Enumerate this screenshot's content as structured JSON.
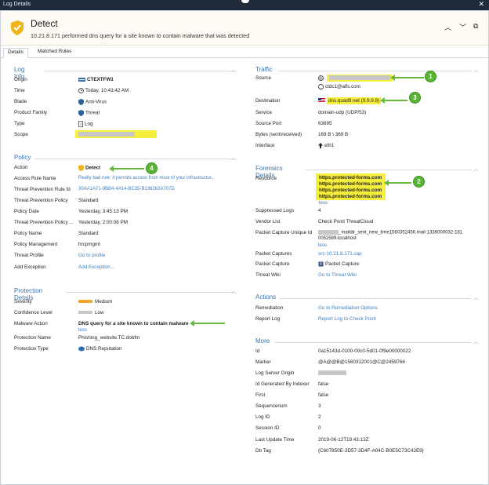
{
  "window": {
    "title": "Log Details",
    "close": "✕"
  },
  "header": {
    "title": "Detect",
    "subtitle": "10.21.8.171 performed dns query for a site known to contain malware that was detected",
    "prev": "︿",
    "next": "﹀",
    "copy": "⧉"
  },
  "tabs": [
    "Details",
    "Matched Rules"
  ],
  "log_info": {
    "title": "Log Info",
    "rows": [
      {
        "label": "Origin",
        "value": "CTEXTFW1"
      },
      {
        "label": "Time",
        "value": "Today, 10:43:42 AM"
      },
      {
        "label": "Blade",
        "value": "Anti-Virus"
      },
      {
        "label": "Product Family",
        "value": "Threat"
      },
      {
        "label": "Type",
        "value": "Log"
      },
      {
        "label": "Scope",
        "value": ""
      }
    ]
  },
  "policy": {
    "title": "Policy",
    "rows": [
      {
        "label": "Action",
        "value": "Detect"
      },
      {
        "label": "Access Rule Name",
        "value": "Really bad rule: it permits access from most of your infrastructur..."
      },
      {
        "label": "Threat Prevention Rule Id",
        "value": "30AA1A71-9BB4-4A14-BC35-B138262A707D"
      },
      {
        "label": "Threat Prevention Policy",
        "value": "Standard"
      },
      {
        "label": "Policy Date",
        "value": "Yesterday, 3:45:13 PM"
      },
      {
        "label": "Threat Prevention Policy ...",
        "value": "Yesterday, 2:00:08 PM"
      },
      {
        "label": "Policy Name",
        "value": "Standard"
      },
      {
        "label": "Policy Management",
        "value": "hrcpmgmt"
      },
      {
        "label": "Threat Profile",
        "value": "Go to profile"
      },
      {
        "label": "Add Exception",
        "value": "Add Exception..."
      }
    ]
  },
  "protection": {
    "title": "Protection Details",
    "rows": [
      {
        "label": "Severity",
        "value": "Medium"
      },
      {
        "label": "Confidence Level",
        "value": "Low"
      },
      {
        "label": "Malware Action",
        "value": "DNS query for a site known to contain malware"
      },
      {
        "label": "",
        "value": "less"
      },
      {
        "label": "Protection Name",
        "value": "Phishing_website.TC.dobfm"
      },
      {
        "label": "Protection Type",
        "value": "DNS Reputation"
      }
    ]
  },
  "traffic": {
    "title": "Traffic",
    "rows": [
      {
        "label": "Source",
        "value": ""
      },
      {
        "label": "",
        "value": "ctdc1@alfs.com"
      },
      {
        "label": "Destination",
        "value": "dns.quad9.net (9.9.9.9)"
      },
      {
        "label": "Service",
        "value": "domain-udp (UDP/53)"
      },
      {
        "label": "Source Port",
        "value": "63695"
      },
      {
        "label": "Bytes (sent\\received)",
        "value": "169 B \\ 369 B"
      },
      {
        "label": "Interface",
        "value": "eth1"
      }
    ]
  },
  "forensics": {
    "title": "Forensics Details",
    "resource_label": "Resource",
    "resources": [
      "https.protected-forms.com",
      "https.protected-forms.com",
      "https.protected-forms.com",
      "https.protected-forms.com"
    ],
    "resource_less": "less",
    "rows": [
      {
        "label": "Suppressed Logs",
        "value": "4"
      },
      {
        "label": "Vendor List",
        "value": "Check Point ThreatCloud"
      },
      {
        "label": "Packet Capture Unique Id",
        "value": "_maildir_sent_new_time1560352456.mail-1336000032-181"
      },
      {
        "label": "",
        "value": "0052589.localhost"
      },
      {
        "label": "",
        "value": "less"
      },
      {
        "label": "Packet Captures",
        "value": "src-10.21.8.171.cap"
      },
      {
        "label": "Packet Capture",
        "value": "Packet Capture"
      },
      {
        "label": "Threat Wiki",
        "value": "Go to Threat Wiki"
      }
    ]
  },
  "actions": {
    "title": "Actions",
    "rows": [
      {
        "label": "Remediation",
        "value": "Go to Remediation Options"
      },
      {
        "label": "Report Log",
        "value": "Report Log to Check Point"
      }
    ]
  },
  "more": {
    "title": "More",
    "rows": [
      {
        "label": "Id",
        "value": "0a15143d-0100-00c0-5d01-0f9e00000022"
      },
      {
        "label": "Marker",
        "value": "@A@@B@1560312001@C@2459766"
      },
      {
        "label": "Log Server Origin",
        "value": ""
      },
      {
        "label": "Id Generated By Indexer",
        "value": "false"
      },
      {
        "label": "First",
        "value": "false"
      },
      {
        "label": "Sequencenum",
        "value": "3"
      },
      {
        "label": "Log ID",
        "value": "2"
      },
      {
        "label": "Session ID",
        "value": "0"
      },
      {
        "label": "Last Update Time",
        "value": "2019-06-12T19:43:13Z"
      },
      {
        "label": "Db Tag",
        "value": "{C607850E-3D57-3D4F-A04C-B0E5C73C42E9}"
      }
    ]
  },
  "callouts": [
    "1",
    "2",
    "3",
    "4"
  ],
  "colors": {
    "accent": "#3b73b0",
    "link": "#3e7fc0",
    "highlight": "#f6ee3c",
    "callout": "#59b534"
  }
}
